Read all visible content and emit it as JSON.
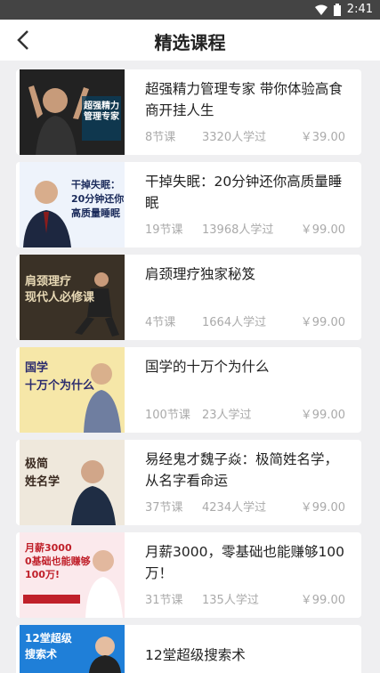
{
  "status": {
    "time": "2:41"
  },
  "nav": {
    "title": "精选课程"
  },
  "courses": [
    {
      "title": "超强精力管理专家 带你体验高食商开挂人生",
      "lessons": "8节课",
      "learners": "3320人学过",
      "price": "￥39.00",
      "thumb_text": "超强精力\n管理专家"
    },
    {
      "title": "干掉失眠：20分钟还你高质量睡眠",
      "lessons": "19节课",
      "learners": "13968人学过",
      "price": "￥99.00",
      "thumb_text": "干掉失眠：\n20分钟还你\n高质量睡眠"
    },
    {
      "title": "肩颈理疗独家秘笈",
      "lessons": "4节课",
      "learners": "1664人学过",
      "price": "￥99.00",
      "thumb_text": "肩颈理疗\n现代人必修课"
    },
    {
      "title": "国学的十万个为什么",
      "lessons": "100节课",
      "learners": "23人学过",
      "price": "￥99.00",
      "thumb_text": "国学\n十万个为什么"
    },
    {
      "title": "易经鬼才魏子焱：极简姓名学，从名字看命运",
      "lessons": "37节课",
      "learners": "4234人学过",
      "price": "￥99.00",
      "thumb_text": "极简\n姓名学"
    },
    {
      "title": "月薪3000，零基础也能赚够100万！",
      "lessons": "31节课",
      "learners": "135人学过",
      "price": "￥99.00",
      "thumb_text": "月薪3000\n0基础也能赚够\n100万!"
    },
    {
      "title": "12堂超级搜索术",
      "lessons": "",
      "learners": "",
      "price": "",
      "thumb_text": "12堂超级\n搜索术"
    }
  ]
}
